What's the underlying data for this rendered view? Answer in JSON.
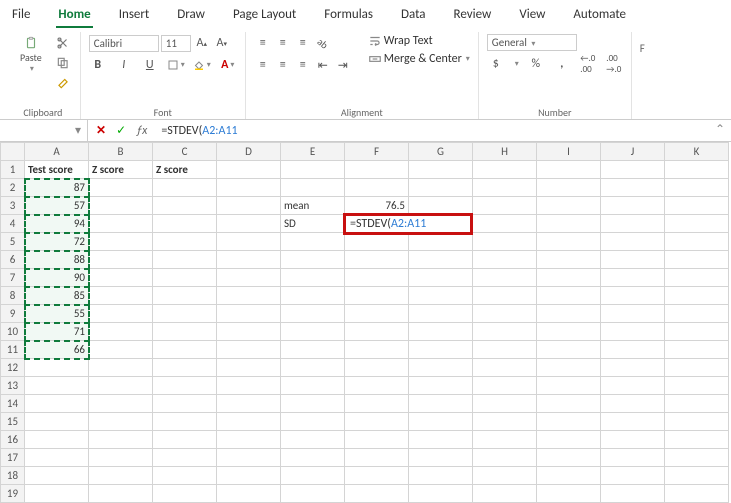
{
  "tabs": {
    "file": "File",
    "home": "Home",
    "insert": "Insert",
    "draw": "Draw",
    "page_layout": "Page Layout",
    "formulas": "Formulas",
    "data": "Data",
    "review": "Review",
    "view": "View",
    "automate": "Automate"
  },
  "ribbon": {
    "clipboard": {
      "paste": "Paste",
      "group": "Clipboard"
    },
    "font": {
      "name": "Calibri",
      "size": "11",
      "bold": "B",
      "italic": "I",
      "underline": "U",
      "group": "Font"
    },
    "alignment": {
      "wrap": "Wrap Text",
      "merge": "Merge & Center",
      "group": "Alignment"
    },
    "number": {
      "format": "General",
      "currency": "$",
      "percent": "%",
      "comma": ",",
      "inc_dec_a": ".0",
      "inc_dec_b": ".00",
      "group": "Number"
    },
    "cells_hint": "F"
  },
  "formula_bar": {
    "namebox": "",
    "formula_prefix": "=STDEV(",
    "formula_ref": "A2:A11"
  },
  "columns": [
    "A",
    "B",
    "C",
    "D",
    "E",
    "F",
    "G",
    "H",
    "I",
    "J",
    "K"
  ],
  "headers": {
    "a1": "Test score",
    "b1": "Z score",
    "c1": "Z score"
  },
  "data_a": [
    "87",
    "57",
    "94",
    "72",
    "88",
    "90",
    "85",
    "55",
    "71",
    "66"
  ],
  "side": {
    "e3_label": "mean",
    "f3_value": "76.5",
    "e4_label": "SD",
    "f4_formula_prefix": "=STDEV(",
    "f4_formula_ref": "A2:A11"
  },
  "chart_data": null
}
